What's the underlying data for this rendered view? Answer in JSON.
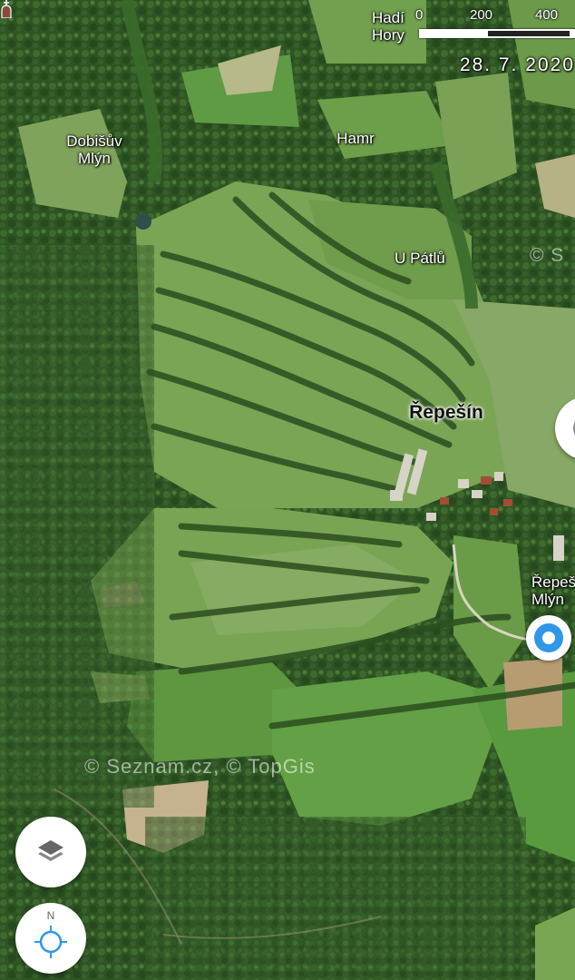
{
  "map": {
    "type": "aerial-photo",
    "accent_color": "#2e97e8",
    "labels": [
      {
        "id": "hadi-hory",
        "text": "Hadí\nHory"
      },
      {
        "id": "dobisuv-mlyn",
        "text": "Dobišův\nMlýn"
      },
      {
        "id": "hamr",
        "text": "Hamr"
      },
      {
        "id": "u-patlu",
        "text": "U Pátlů"
      },
      {
        "id": "repesin",
        "text": "Řepešín"
      },
      {
        "id": "repesinsky-mlyn",
        "text": "Řepeš\nMlýn"
      }
    ],
    "scale": {
      "ticks": [
        "0",
        "200",
        "400"
      ],
      "unit": "m"
    },
    "imagery_date": "28. 7. 2020",
    "copyright_top": "© S",
    "copyright_center": "© Seznam.cz, © TopGis"
  },
  "controls": {
    "layers_icon": "layers-icon",
    "compass_north": "N",
    "compass_icon": "locate-icon",
    "side_icon": "chevron-icon"
  }
}
